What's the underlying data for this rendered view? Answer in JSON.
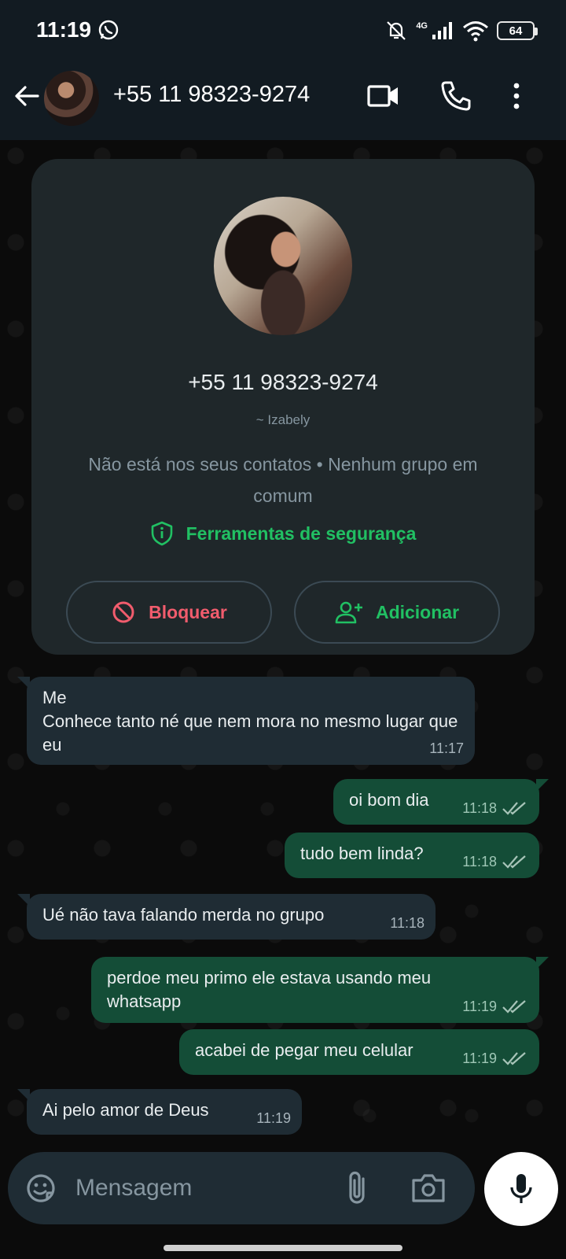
{
  "status_bar": {
    "time": "11:19",
    "network": "4G",
    "battery": "64"
  },
  "header": {
    "title": "+55 11 98323-9274"
  },
  "info_card": {
    "number": "+55 11 98323-9274",
    "name": "~ Izabely",
    "note": "Não está nos seus contatos • Nenhum grupo em comum",
    "safety_label": "Ferramentas de segurança",
    "block_label": "Bloquear",
    "add_label": "Adicionar"
  },
  "messages": [
    {
      "direction": "in",
      "text": "Me\nConhece tanto né que nem mora no mesmo lugar que eu",
      "time": "11:17"
    },
    {
      "direction": "out",
      "text": "oi bom dia",
      "time": "11:18",
      "status": "read"
    },
    {
      "direction": "out",
      "text": "tudo bem linda?",
      "time": "11:18",
      "status": "read"
    },
    {
      "direction": "in",
      "text": "Ué não tava falando merda no grupo",
      "time": "11:18"
    },
    {
      "direction": "out",
      "text": "perdoe meu primo ele estava usando meu whatsapp",
      "time": "11:19",
      "status": "read"
    },
    {
      "direction": "out",
      "text": "acabei de pegar meu celular",
      "time": "11:19",
      "status": "read"
    },
    {
      "direction": "in",
      "text": "Ai pelo amor de Deus",
      "time": "11:19"
    }
  ],
  "composer": {
    "placeholder": "Mensagem"
  },
  "colors": {
    "accent": "#21c063",
    "danger": "#f15c6d",
    "outgoing_bubble": "#144d37",
    "incoming_bubble": "#1f2c34"
  }
}
